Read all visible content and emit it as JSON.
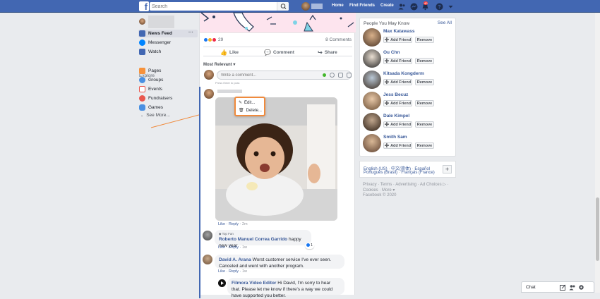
{
  "topbar": {
    "search_placeholder": "Search",
    "nav": [
      "Home",
      "Find Friends",
      "Create"
    ],
    "notification_count": "40",
    "logo": "f"
  },
  "left_nav": {
    "items": [
      {
        "label": "News Feed",
        "icon": "news-feed-icon",
        "color": "#4267b2"
      },
      {
        "label": "Messenger",
        "icon": "messenger-icon",
        "color": "#0084ff"
      },
      {
        "label": "Watch",
        "icon": "watch-icon",
        "color": "#4267b2"
      }
    ],
    "explore_label": "Explore",
    "explore_items": [
      {
        "label": "Pages",
        "icon": "pages-icon",
        "color": "#f7923b"
      },
      {
        "label": "Groups",
        "icon": "groups-icon",
        "color": "#4a90e2"
      },
      {
        "label": "Events",
        "icon": "events-icon",
        "color": "#e9574e"
      },
      {
        "label": "Fundraisers",
        "icon": "fundraisers-icon",
        "color": "#e9574e"
      },
      {
        "label": "Games",
        "icon": "games-icon",
        "color": "#4a90e2"
      }
    ],
    "see_more": "See More..."
  },
  "post": {
    "reaction_count": "29",
    "comment_count": "8 Comments",
    "actions": [
      "Like",
      "Comment",
      "Share"
    ],
    "sort_label": "Most Relevant",
    "comment_placeholder": "Write a comment...",
    "press_enter": "Press Enter to post.",
    "menu": [
      "Edit...",
      "Delete..."
    ]
  },
  "comments": [
    {
      "meta_like": "Like",
      "meta_reply": "Reply",
      "time": "2m"
    },
    {
      "badge": "Top Fan",
      "name": "Roberto Manuel Correa Garrido",
      "text": "happy new year",
      "like": "Like",
      "reply": "Reply",
      "time": "1w",
      "reaction_count": "1"
    },
    {
      "name": "David A. Arana",
      "text": "Worst customer service I've ever seen. Canceled and went with another program.",
      "like": "Like",
      "reply": "Reply",
      "time": "1w"
    },
    {
      "name": "Filmora Video Editor",
      "text": "Hi David, I'm sorry to hear that. Please let me know if there's a way we could have supported you better."
    }
  ],
  "people": {
    "title": "People You May Know",
    "see_all": "See All",
    "add_label": "Add Friend",
    "remove_label": "Remove",
    "list": [
      "Max Katawass",
      "Ou Chn",
      "Kitsada Kongderm",
      "Jess Becuz",
      "Dale Kimpel",
      "Smith Sam"
    ]
  },
  "languages": {
    "line1_a": "English (US)",
    "line1_b": "中文(简体)",
    "line1_c": "Español",
    "line2_a": "Português (Brasil)",
    "line2_b": "Français (France)",
    "sep": "·",
    "plus": "+"
  },
  "footer": {
    "line1": "Privacy · Terms · Advertising · Ad Choices ▷ ·",
    "line2": "Cookies · More ▾",
    "line3": "Facebook © 2020"
  },
  "chat": {
    "label": "Chat"
  },
  "colors": {
    "brand": "#4267b2",
    "link": "#385898",
    "accent_orange": "#f08a3c"
  }
}
